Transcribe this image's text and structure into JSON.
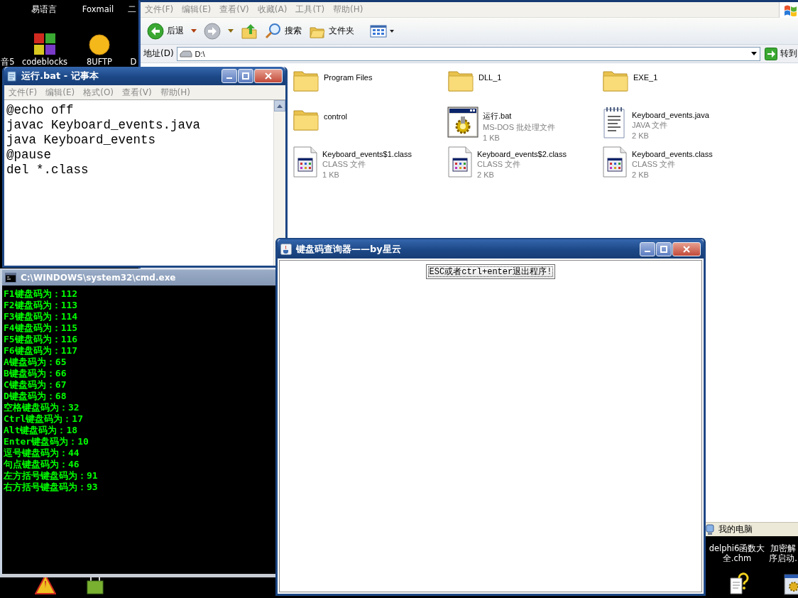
{
  "desktop_icons": [
    {
      "label": "易语言"
    },
    {
      "label": "Foxmail"
    },
    {
      "label": "二"
    },
    {
      "label": "音5"
    },
    {
      "label": "codeblocks",
      "kind": "blocks"
    },
    {
      "label": "8UFTP",
      "kind": "ball"
    },
    {
      "label": "D"
    },
    {
      "kind": "warning"
    },
    {
      "kind": "bag"
    },
    {
      "lines": [
        "delphi6函数大",
        "全.chm"
      ]
    },
    {
      "lines": [
        "加密解",
        "序启动."
      ]
    },
    {
      "kind": "help"
    },
    {
      "kind": "app"
    }
  ],
  "explorer": {
    "menu": [
      "文件(F)",
      "编辑(E)",
      "查看(V)",
      "收藏(A)",
      "工具(T)",
      "帮助(H)"
    ],
    "toolbar": {
      "back": "后退",
      "search": "搜索",
      "folders": "文件夹"
    },
    "address": {
      "label": "地址(D)",
      "value": "D:\\",
      "go": "转到"
    },
    "files": [
      {
        "name": "Program Files",
        "kind": "folder"
      },
      {
        "name": "DLL_1",
        "kind": "folder"
      },
      {
        "name": "EXE_1",
        "kind": "folder"
      },
      {
        "name": "control",
        "kind": "folder"
      },
      {
        "name": "运行.bat",
        "type": "MS-DOS 批处理文件",
        "size": "1 KB",
        "kind": "batch"
      },
      {
        "name": "Keyboard_events.java",
        "type": "JAVA 文件",
        "size": "2 KB",
        "kind": "text"
      },
      {
        "name": "Keyboard_events$1.class",
        "type": "CLASS 文件",
        "size": "1 KB",
        "kind": "class"
      },
      {
        "name": "Keyboard_events$2.class",
        "type": "CLASS 文件",
        "size": "2 KB",
        "kind": "class"
      },
      {
        "name": "Keyboard_events.class",
        "type": "CLASS 文件",
        "size": "2 KB",
        "kind": "class"
      }
    ],
    "status": "我的电脑"
  },
  "notepad": {
    "title": "运行.bat - 记事本",
    "menu": [
      "文件(F)",
      "编辑(E)",
      "格式(O)",
      "查看(V)",
      "帮助(H)"
    ],
    "lines": [
      "@echo off",
      "javac Keyboard_events.java",
      "java Keyboard_events",
      "@pause",
      "del *.class"
    ]
  },
  "cmd": {
    "title": "C:\\WINDOWS\\system32\\cmd.exe",
    "lines": [
      "F1键盘码为：112",
      "F2键盘码为：113",
      "F3键盘码为：114",
      "F4键盘码为：115",
      "F5键盘码为：116",
      "F6键盘码为：117",
      "A键盘码为：65",
      "B键盘码为：66",
      "C键盘码为：67",
      "D键盘码为：68",
      "空格键盘码为：32",
      "Ctrl键盘码为：17",
      "Alt键盘码为：18",
      "Enter键盘码为：10",
      "逗号键盘码为：44",
      "句点键盘码为：46",
      "左方括号键盘码为：91",
      "右方括号键盘码为：93"
    ]
  },
  "java_window": {
    "title": "键盘码查询器——by星云",
    "button": "ESC或者ctrl+enter退出程序!"
  }
}
